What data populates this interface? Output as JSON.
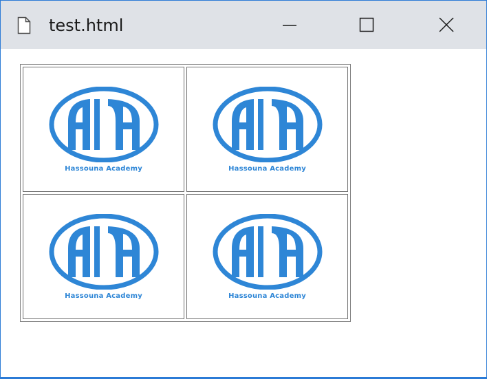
{
  "window": {
    "title": "test.html",
    "icon": "document-icon",
    "controls": [
      "minimize-icon",
      "maximize-icon",
      "close-icon"
    ]
  },
  "grid": {
    "rows": 2,
    "cols": 2,
    "cells": [
      {
        "logo": "ha-logo",
        "caption": "Hassouna Academy"
      },
      {
        "logo": "ha-logo",
        "caption": "Hassouna Academy"
      },
      {
        "logo": "ha-logo",
        "caption": "Hassouna Academy"
      },
      {
        "logo": "ha-logo",
        "caption": "Hassouna Academy"
      }
    ]
  },
  "colors": {
    "titlebar": "#dfe2e7",
    "window_border": "#2b7bd6",
    "logo_blue": "#2e86d6"
  }
}
